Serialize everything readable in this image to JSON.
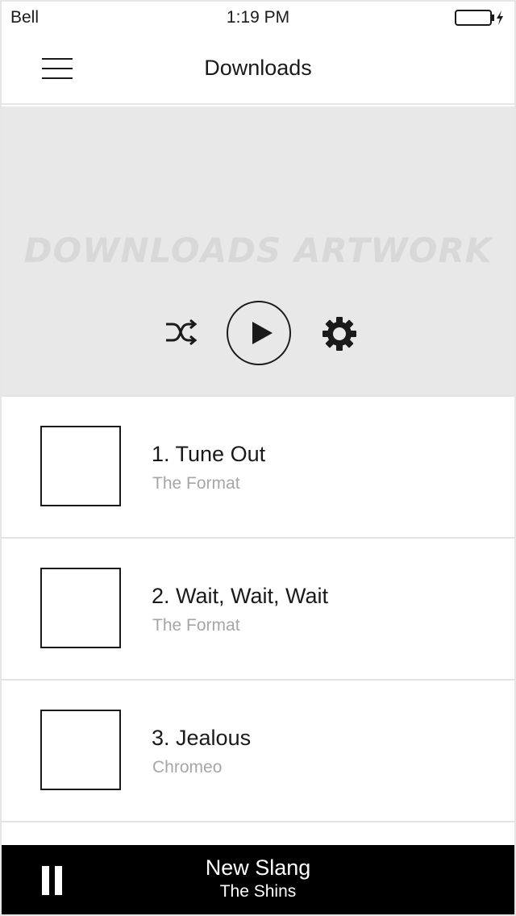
{
  "status_bar": {
    "carrier": "Bell",
    "time": "1:19 PM",
    "battery_icon": "battery-charging-icon"
  },
  "header": {
    "title": "Downloads",
    "menu_icon": "hamburger-menu-icon"
  },
  "artwork": {
    "label": "DOWNLOADS ARTWORK",
    "controls": {
      "shuffle_icon": "shuffle-icon",
      "play_icon": "play-icon",
      "settings_icon": "gear-icon"
    }
  },
  "tracks": [
    {
      "title": "1. Tune Out",
      "artist": "The Format"
    },
    {
      "title": "2. Wait, Wait, Wait",
      "artist": "The Format"
    },
    {
      "title": "3. Jealous",
      "artist": "Chromeo"
    }
  ],
  "now_playing": {
    "title": "New Slang",
    "artist": "The Shins",
    "pause_icon": "pause-icon"
  },
  "colors": {
    "text": "#1a1a1a",
    "secondary_text": "#a6a6a6",
    "artwork_bg": "#e8e8e8",
    "divider": "#e3e3e3",
    "player_bg": "#000000"
  }
}
